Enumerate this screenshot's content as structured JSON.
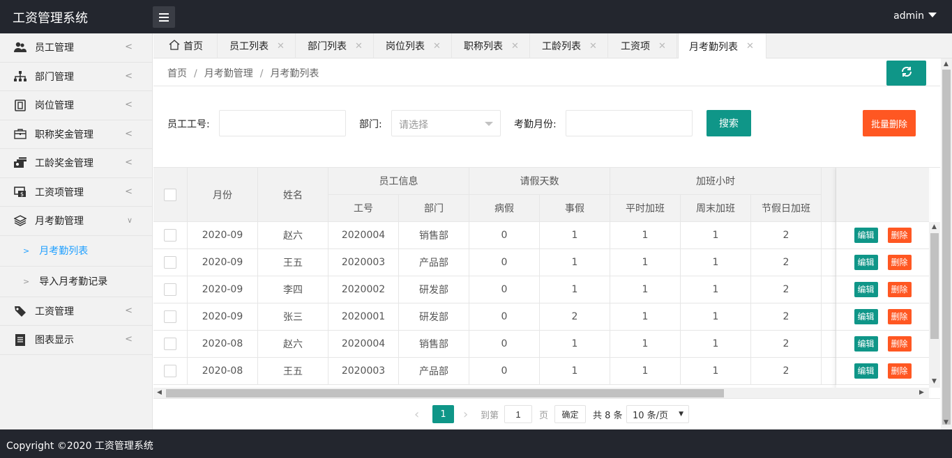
{
  "app": {
    "title": "工资管理系统",
    "user": "admin"
  },
  "sidebar": {
    "items": [
      {
        "label": "员工管理",
        "icon": "users-icon"
      },
      {
        "label": "部门管理",
        "icon": "sitemap-icon"
      },
      {
        "label": "岗位管理",
        "icon": "badge-icon"
      },
      {
        "label": "职称奖金管理",
        "icon": "briefcase-icon"
      },
      {
        "label": "工龄奖金管理",
        "icon": "money-stack-icon"
      },
      {
        "label": "工资项管理",
        "icon": "salary-item-icon"
      },
      {
        "label": "月考勤管理",
        "icon": "layers-icon"
      },
      {
        "label": "工资管理",
        "icon": "tag-icon"
      },
      {
        "label": "图表显示",
        "icon": "document-icon"
      }
    ],
    "sub": [
      {
        "label": "月考勤列表"
      },
      {
        "label": "导入月考勤记录"
      }
    ]
  },
  "tabs": [
    {
      "label": "首页"
    },
    {
      "label": "员工列表"
    },
    {
      "label": "部门列表"
    },
    {
      "label": "岗位列表"
    },
    {
      "label": "职称列表"
    },
    {
      "label": "工龄列表"
    },
    {
      "label": "工资项"
    },
    {
      "label": "月考勤列表"
    }
  ],
  "breadcrumb": [
    "首页",
    "月考勤管理",
    "月考勤列表"
  ],
  "filters": {
    "emp_no_label": "员工工号:",
    "emp_no_value": "",
    "dept_label": "部门:",
    "dept_placeholder": "请选择",
    "month_label": "考勤月份:",
    "month_value": "",
    "search": "搜索",
    "batch_delete": "批量删除"
  },
  "table": {
    "headers": {
      "month": "月份",
      "name": "姓名",
      "emp_info": "员工信息",
      "leave": "请假天数",
      "overtime": "加班小时",
      "emp_no": "工号",
      "dept": "部门",
      "sick": "病假",
      "personal": "事假",
      "weekday_ot": "平时加班",
      "weekend_ot": "周末加班",
      "holiday_ot": "节假日加班"
    },
    "edit_label": "编辑",
    "delete_label": "删除",
    "rows": [
      {
        "month": "2020-09",
        "name": "赵六",
        "emp_no": "2020004",
        "dept": "销售部",
        "sick": "0",
        "personal": "1",
        "weekday_ot": "1",
        "weekend_ot": "1",
        "holiday_ot": "2"
      },
      {
        "month": "2020-09",
        "name": "王五",
        "emp_no": "2020003",
        "dept": "产品部",
        "sick": "0",
        "personal": "1",
        "weekday_ot": "1",
        "weekend_ot": "1",
        "holiday_ot": "2"
      },
      {
        "month": "2020-09",
        "name": "李四",
        "emp_no": "2020002",
        "dept": "研发部",
        "sick": "0",
        "personal": "1",
        "weekday_ot": "1",
        "weekend_ot": "1",
        "holiday_ot": "2"
      },
      {
        "month": "2020-09",
        "name": "张三",
        "emp_no": "2020001",
        "dept": "研发部",
        "sick": "0",
        "personal": "2",
        "weekday_ot": "1",
        "weekend_ot": "1",
        "holiday_ot": "2"
      },
      {
        "month": "2020-08",
        "name": "赵六",
        "emp_no": "2020004",
        "dept": "销售部",
        "sick": "0",
        "personal": "1",
        "weekday_ot": "1",
        "weekend_ot": "1",
        "holiday_ot": "2"
      },
      {
        "month": "2020-08",
        "name": "王五",
        "emp_no": "2020003",
        "dept": "产品部",
        "sick": "0",
        "personal": "1",
        "weekday_ot": "1",
        "weekend_ot": "1",
        "holiday_ot": "2"
      }
    ]
  },
  "pager": {
    "current": "1",
    "goto_label": "到第",
    "goto_value": "1",
    "page_label": "页",
    "confirm": "确定",
    "total": "共 8 条",
    "per_page": "10 条/页"
  },
  "footer": {
    "copyright": "Copyright ©2020 工资管理系统"
  },
  "colors": {
    "primary": "#0f9688",
    "danger": "#ff5722",
    "header": "#23262e",
    "link": "#1e9fff"
  }
}
